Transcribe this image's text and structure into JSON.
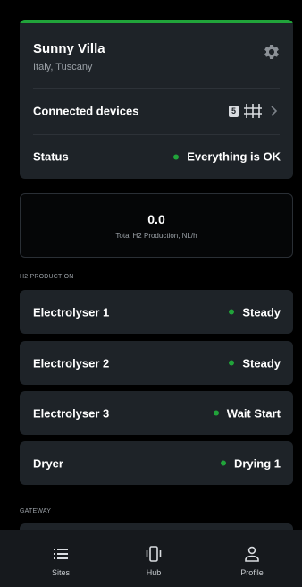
{
  "site": {
    "name": "Sunny Villa",
    "location": "Italy, Tuscany",
    "accent_color": "#21a33a"
  },
  "connected_devices": {
    "label": "Connected devices",
    "count": "5"
  },
  "status": {
    "label": "Status",
    "value": "Everything is OK",
    "color": "#21a33a"
  },
  "production": {
    "value": "0.0",
    "label": "Total H2 Production, NL/h"
  },
  "sections": {
    "h2_production": "H2 PRODUCTION",
    "gateway": "GATEWAY"
  },
  "devices": [
    {
      "name": "Electrolyser 1",
      "state": "Steady"
    },
    {
      "name": "Electrolyser 2",
      "state": "Steady"
    },
    {
      "name": "Electrolyser 3",
      "state": "Wait Start"
    },
    {
      "name": "Dryer",
      "state": "Drying 1"
    }
  ],
  "nav": {
    "sites": {
      "label": "Sites",
      "icon": "list-icon"
    },
    "hub": {
      "label": "Hub",
      "icon": "phone-vibrate-icon"
    },
    "profile": {
      "label": "Profile",
      "icon": "person-icon"
    }
  }
}
